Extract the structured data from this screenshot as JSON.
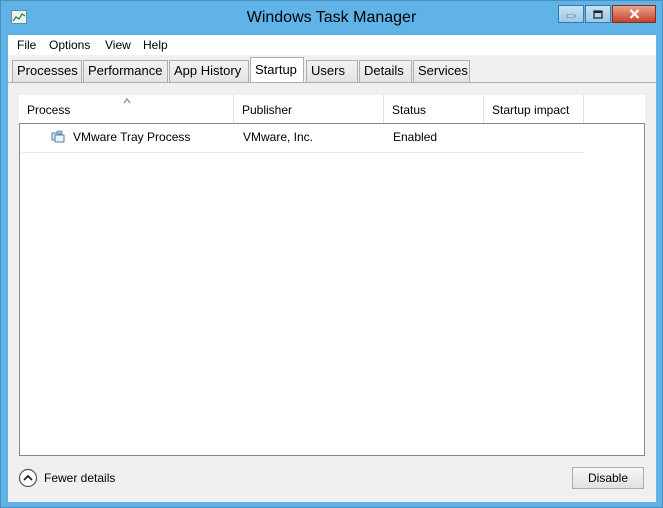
{
  "window": {
    "title": "Windows Task Manager",
    "accent_color": "#5fb3e6"
  },
  "menu": [
    "File",
    "Options",
    "View",
    "Help"
  ],
  "tabs": [
    {
      "label": "Processes",
      "active": false
    },
    {
      "label": "Performance",
      "active": false
    },
    {
      "label": "App History",
      "active": false
    },
    {
      "label": "Startup",
      "active": true
    },
    {
      "label": "Users",
      "active": false
    },
    {
      "label": "Details",
      "active": false
    },
    {
      "label": "Services",
      "active": false
    }
  ],
  "table": {
    "columns": [
      "Process",
      "Publisher",
      "Status",
      "Startup impact"
    ],
    "sort_column": "Process",
    "sort_direction": "ascending",
    "rows": [
      {
        "icon": "application-icon",
        "process": "VMware Tray Process",
        "publisher": "VMware, Inc.",
        "status": "Enabled",
        "impact": ""
      }
    ]
  },
  "footer": {
    "fewer_details_label": "Fewer details",
    "disable_label": "Disable"
  }
}
